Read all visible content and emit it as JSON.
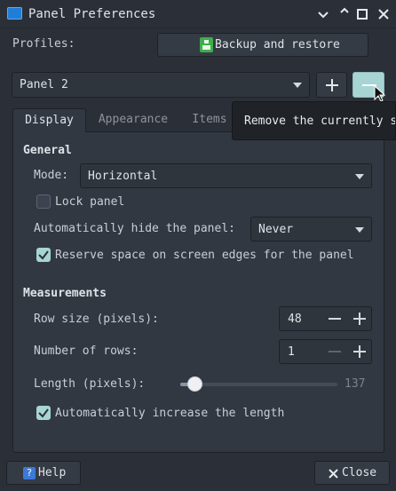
{
  "window": {
    "title": "Panel Preferences",
    "controls": [
      "minimize-icon",
      "restore-icon",
      "maximize-icon",
      "close-icon"
    ]
  },
  "profiles": {
    "label": "Profiles:",
    "backup_button": "Backup and restore",
    "backup_icon": "backup-icon"
  },
  "panel_select": {
    "value": "Panel 2",
    "add_icon": "plus-icon",
    "remove_icon": "minus-icon"
  },
  "tooltip": {
    "text": "Remove the currently selected panel"
  },
  "tabs": [
    {
      "label": "Display",
      "active": true
    },
    {
      "label": "Appearance",
      "active": false
    },
    {
      "label": "Items",
      "active": false
    }
  ],
  "general": {
    "heading": "General",
    "mode_label": "Mode:",
    "mode_value": "Horizontal",
    "lock_label": "Lock panel",
    "lock_checked": false,
    "autohide_label": "Automatically hide the panel:",
    "autohide_value": "Never",
    "reserve_label": "Reserve space on screen edges for the panel",
    "reserve_checked": true
  },
  "measurements": {
    "heading": "Measurements",
    "row_size_label": "Row size (pixels):",
    "row_size_value": "48",
    "rows_label": "Number of rows:",
    "rows_value": "1",
    "length_label": "Length (pixels):",
    "length_value": "137",
    "length_fraction": 0.09,
    "auto_length_label": "Automatically increase the length",
    "auto_length_checked": true
  },
  "footer": {
    "help_label": "Help",
    "close_label": "Close"
  },
  "colors": {
    "accent": "#a7d5d3",
    "background": "#2b3038",
    "panel": "#323842",
    "help_icon_bg": "#3d79d6",
    "backup_icon_bg": "#3fae4a"
  }
}
